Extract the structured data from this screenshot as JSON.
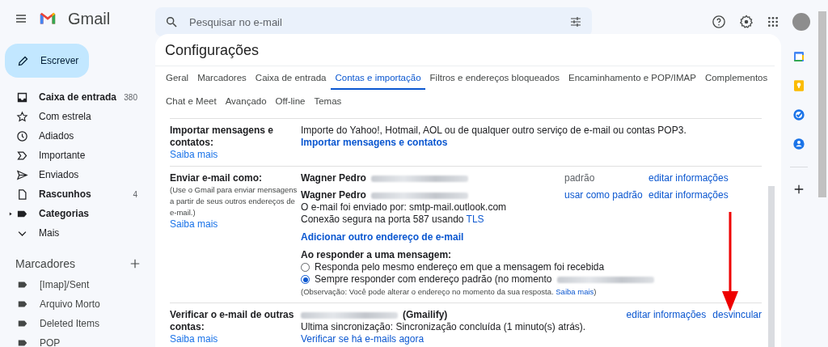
{
  "header": {
    "product": "Gmail",
    "search": {
      "placeholder": "Pesquisar no e-mail"
    }
  },
  "compose": "Escrever",
  "nav": [
    {
      "kind": "inbox",
      "label": "Caixa de entrada",
      "count": "380",
      "bold": true,
      "has_children": false
    },
    {
      "kind": "star",
      "label": "Com estrela",
      "bold": false,
      "has_children": false
    },
    {
      "kind": "clock",
      "label": "Adiados",
      "bold": false,
      "has_children": false
    },
    {
      "kind": "important",
      "label": "Importante",
      "bold": false,
      "has_children": false
    },
    {
      "kind": "sent",
      "label": "Enviados",
      "bold": false,
      "has_children": false
    },
    {
      "kind": "draft",
      "label": "Rascunhos",
      "count": "4",
      "bold": true,
      "has_children": false
    },
    {
      "kind": "label",
      "label": "Categorias",
      "bold": true,
      "has_children": true
    },
    {
      "kind": "more",
      "label": "Mais",
      "bold": false,
      "has_children": false
    }
  ],
  "labels_header": "Marcadores",
  "labels": [
    "[Imap]/Sent",
    "Arquivo Morto",
    "Deleted Items",
    "POP"
  ],
  "settings": {
    "title": "Configurações",
    "tabs": [
      {
        "label": "Geral",
        "selected": false
      },
      {
        "label": "Marcadores",
        "selected": false
      },
      {
        "label": "Caixa de entrada",
        "selected": false
      },
      {
        "label": "Contas e importação",
        "selected": true
      },
      {
        "label": "Filtros e endereços bloqueados",
        "selected": false
      },
      {
        "label": "Encaminhamento e POP/IMAP",
        "selected": false
      },
      {
        "label": "Complementos",
        "selected": false
      },
      {
        "label": "Chat e Meet",
        "selected": false
      },
      {
        "label": "Avançado",
        "selected": false
      },
      {
        "label": "Off-line",
        "selected": false
      },
      {
        "label": "Temas",
        "selected": false
      }
    ],
    "import": {
      "label": "Importar mensagens e contatos:",
      "learn_more": "Saiba mais",
      "description": "Importe do Yahoo!, Hotmail, AOL ou de qualquer outro serviço de e-mail ou contas POP3.",
      "link": "Importar mensagens e contatos"
    },
    "send_as": {
      "label": "Enviar e-mail como:",
      "note": "(Use o Gmail para enviar mensagens a partir de seus outros endereços de e-mail.)",
      "learn_more": "Saiba mais",
      "accounts": [
        {
          "name": "Wagner Pedro",
          "address_redacted": true,
          "status": {
            "kind": "text",
            "text": "padrão"
          },
          "action": "editar informações"
        },
        {
          "name": "Wagner Pedro",
          "address_redacted": true,
          "status": {
            "kind": "link",
            "text": "usar como padrão"
          },
          "action": "editar informações",
          "sent_via": "O e-mail foi enviado por: smtp-mail.outlook.com",
          "secure_text": "Conexão segura na porta 587 usando",
          "secure_link": "TLS"
        }
      ],
      "add_link": "Adicionar outro endereço de e-mail",
      "reply_heading": "Ao responder a uma mensagem:",
      "reply_options": [
        {
          "label": "Responda pelo mesmo endereço em que a mensagem foi recebida",
          "address_redacted": false,
          "selected": false
        },
        {
          "label": "Sempre responder com endereço padrão (no momento",
          "address_redacted": true,
          "selected": true
        }
      ],
      "reply_note": "(Observação: Você pode alterar o endereço no momento da sua resposta.",
      "reply_note_link": "Saiba mais",
      "reply_note_end": ")"
    },
    "check_mail": {
      "label": "Verificar o e-mail de outras contas:",
      "learn_more": "Saiba mais",
      "address_redacted": true,
      "account_type": "(Gmailify)",
      "actions": [
        "editar informações",
        "desvincular"
      ],
      "sync": "Ultima sincronização: Sincronização concluída (1 minuto(s) atrás).",
      "check_link": "Verificar se há e-mails agora"
    }
  }
}
